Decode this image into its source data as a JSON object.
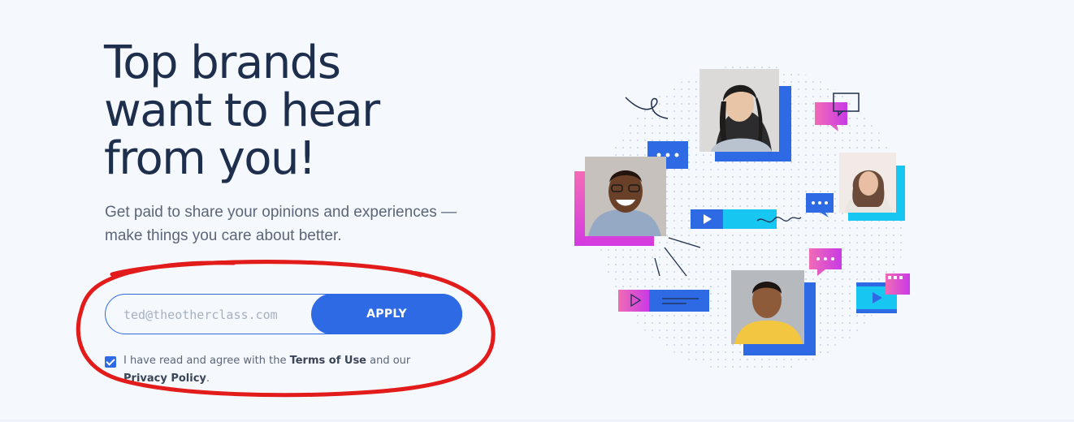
{
  "hero": {
    "title": "Top brands\nwant to hear\nfrom you!",
    "subtitle": "Get paid to share your opinions and experiences —make things you care about better."
  },
  "signup": {
    "email_value": "ted@theotherclass.com",
    "apply_label": "APPLY",
    "agree_prefix": "I have read and agree with the ",
    "terms_link": "Terms of Use",
    "agree_middle": " and our ",
    "privacy_link": "Privacy Policy",
    "agree_suffix": ".",
    "checkbox_checked": true
  },
  "annotation": {
    "color": "#e21b1b",
    "shape": "hand-drawn-ellipse"
  },
  "colors": {
    "primary_blue": "#2d6ae3",
    "title_navy": "#1e2f4d",
    "magenta": "#e63ad1",
    "cyan": "#17c7f2",
    "background": "#f5f8fc"
  },
  "illustration": {
    "icons": [
      "chat-bubble-icon",
      "play-icon",
      "video-clip-icon",
      "squiggle-line-icon"
    ],
    "people": [
      "woman-with-headphones",
      "smiling-man-with-glasses",
      "woman-curly-hair",
      "man-yellow-shirt"
    ]
  }
}
